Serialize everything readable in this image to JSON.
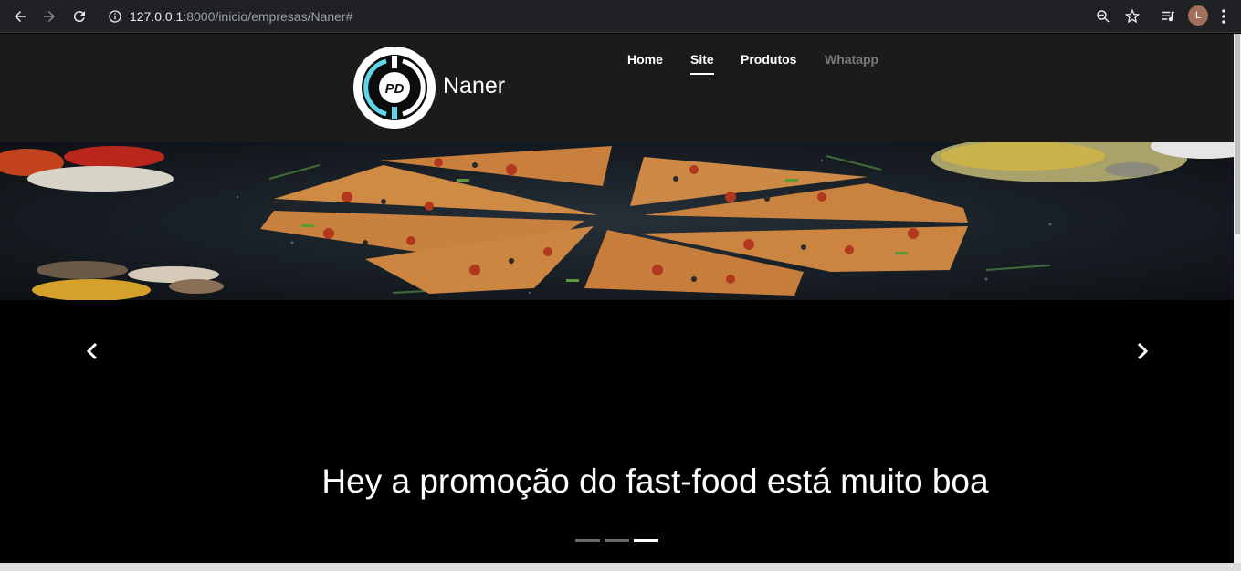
{
  "browser": {
    "url_host": "127.0.0.1",
    "url_path": ":8000/inicio/empresas/Naner#",
    "avatar_letter": "L"
  },
  "header": {
    "brand": "Naner",
    "logo_text": "PD",
    "menu": [
      {
        "label": "Home",
        "state": "normal"
      },
      {
        "label": "Site",
        "state": "active"
      },
      {
        "label": "Produtos",
        "state": "normal"
      },
      {
        "label": "Whatapp",
        "state": "disabled"
      }
    ]
  },
  "carousel": {
    "caption": "Hey a promoção do fast-food está muito boa",
    "indicators": [
      false,
      false,
      true
    ]
  },
  "colors": {
    "header_bg": "#1b1b1b",
    "logo_accent": "#5fd6e8",
    "page_bg": "#000000"
  }
}
